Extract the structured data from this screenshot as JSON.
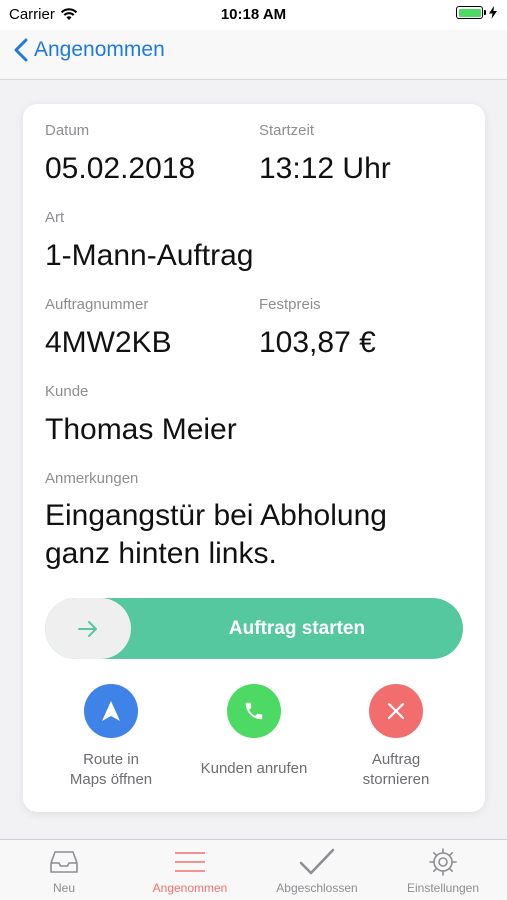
{
  "status_bar": {
    "carrier": "Carrier",
    "time": "10:18 AM"
  },
  "nav": {
    "back_label": "Angenommen"
  },
  "order": {
    "date_label": "Datum",
    "date_value": "05.02.2018",
    "start_label": "Startzeit",
    "start_value": "13:12 Uhr",
    "type_label": "Art",
    "type_value": "1-Mann-Auftrag",
    "number_label": "Auftragnummer",
    "number_value": "4MW2KB",
    "price_label": "Festpreis",
    "price_value": "103,87 €",
    "customer_label": "Kunde",
    "customer_value": "Thomas Meier",
    "notes_label": "Anmerkungen",
    "notes_value": "Eingangstür bei Abholung ganz hinten links."
  },
  "start_slider": {
    "label": "Auftrag starten"
  },
  "actions": {
    "route_line1": "Route in",
    "route_line2": "Maps öffnen",
    "call": "Kunden anrufen",
    "cancel_line1": "Auftrag",
    "cancel_line2": "stornieren"
  },
  "tabs": [
    {
      "label": "Neu",
      "icon": "inbox-icon"
    },
    {
      "label": "Angenommen",
      "icon": "list-icon"
    },
    {
      "label": "Abgeschlossen",
      "icon": "checkmark-icon"
    },
    {
      "label": "Einstellungen",
      "icon": "gear-icon"
    }
  ],
  "colors": {
    "accent": "#1f7ae0",
    "slider": "#55c89f",
    "route": "#3f82e8",
    "call": "#4cd964",
    "cancel": "#f26d6d",
    "active_tab": "#f2716e"
  }
}
